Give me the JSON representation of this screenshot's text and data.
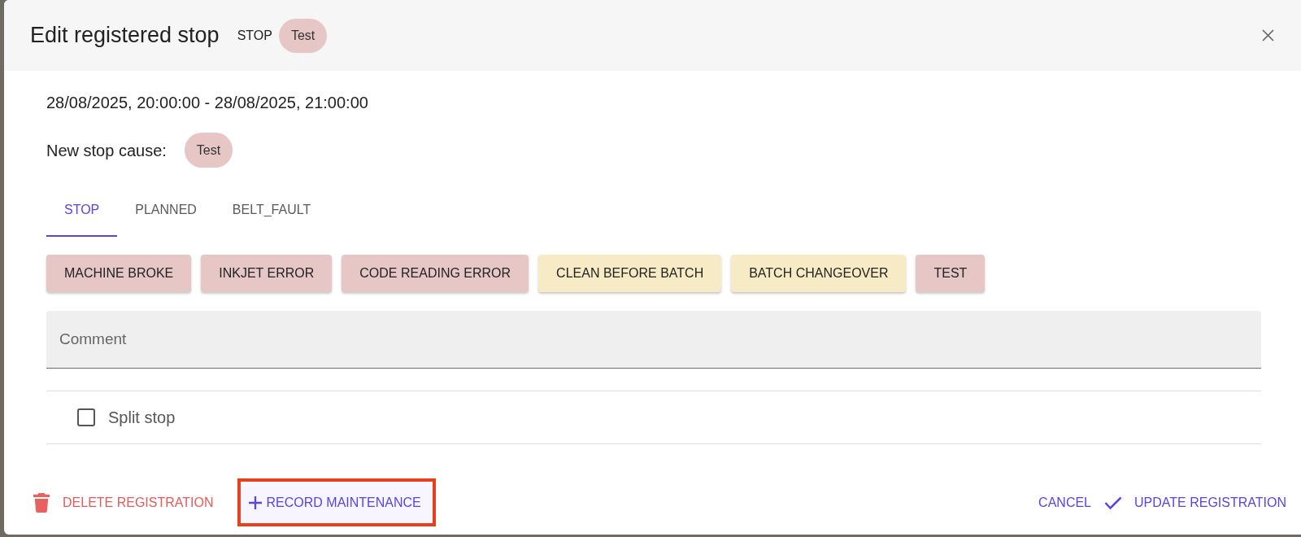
{
  "dialog": {
    "title": "Edit registered stop",
    "category": "STOP",
    "cause": "Test"
  },
  "period": "28/08/2025, 20:00:00 - 28/08/2025, 21:00:00",
  "new_cause": {
    "label": "New stop cause:",
    "value": "Test"
  },
  "tabs": [
    {
      "label": "STOP",
      "selected": true
    },
    {
      "label": "PLANNED",
      "selected": false
    },
    {
      "label": "BELT_FAULT",
      "selected": false
    }
  ],
  "causes": [
    {
      "label": "MACHINE BROKE",
      "color": "#e7c6c6"
    },
    {
      "label": "INKJET ERROR",
      "color": "#e7c6c6"
    },
    {
      "label": "CODE READING ERROR",
      "color": "#e7c6c6"
    },
    {
      "label": "CLEAN BEFORE BATCH",
      "color": "#f7ebc6"
    },
    {
      "label": "BATCH CHANGEOVER",
      "color": "#f7ebc6"
    },
    {
      "label": "TEST",
      "color": "#e7c6c6"
    }
  ],
  "comment": {
    "placeholder": "Comment"
  },
  "split_stop": {
    "label": "Split stop",
    "checked": false
  },
  "footer": {
    "left_actions": [
      {
        "kind": "delete",
        "label": "DELETE REGISTRATION",
        "highlighted": false
      },
      {
        "kind": "add",
        "label": "RECORD MAINTENANCE",
        "highlighted": true
      }
    ],
    "right_actions": [
      {
        "kind": "plain",
        "label": "CANCEL",
        "highlighted": false
      },
      {
        "kind": "confirm",
        "label": "UPDATE REGISTRATION",
        "highlighted": false
      }
    ]
  }
}
